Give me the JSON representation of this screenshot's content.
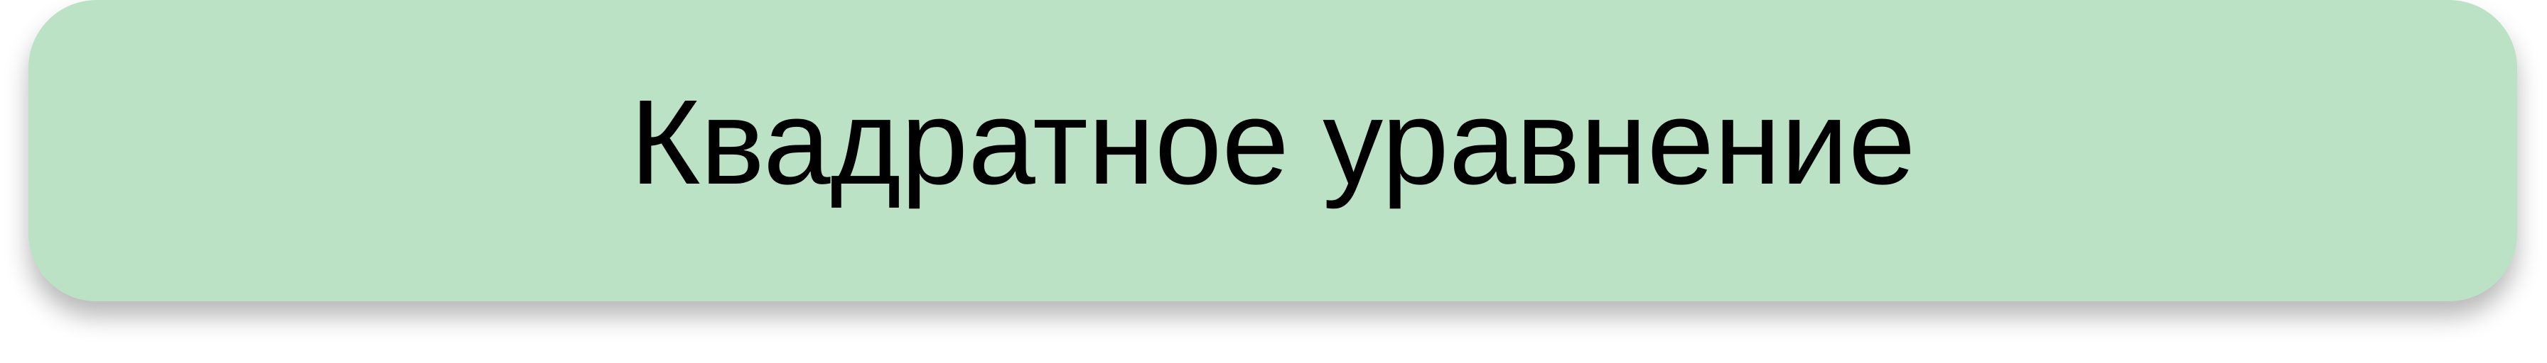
{
  "button": {
    "label": "Квадратное уравнение",
    "background_color": "#bbe2c4",
    "text_color": "#000000"
  }
}
